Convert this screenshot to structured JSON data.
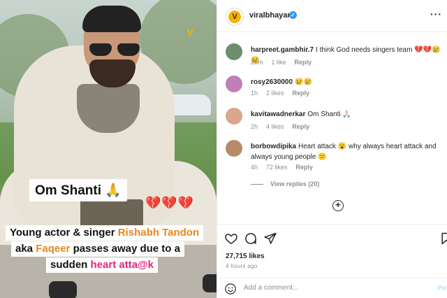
{
  "media": {
    "watermark": "V",
    "overlay_title": "Om Shanti 🙏",
    "hearts": "💔💔💔",
    "caption": {
      "l1_a": "Young actor & singer ",
      "l1_b": "Rishabh Tandon",
      "l2_a": "aka ",
      "l2_b": "Faqeer",
      "l2_c": " passes away due to a",
      "l3_a": "sudden ",
      "l3_b": "heart atta@k"
    }
  },
  "header": {
    "avatar_letter": "V",
    "username": "viralbhayani",
    "verified_mark": "✓",
    "more": "···"
  },
  "comments": [
    {
      "user": "harpreet.gambhir.7",
      "text": "I think God needs singers team 💔💔😢😢",
      "time": "25m",
      "likes": "1 like",
      "reply": "Reply",
      "avatar_color": "#6b8e6b"
    },
    {
      "user": "rosy2630000",
      "text": "😢😢",
      "time": "1h",
      "likes": "2 likes",
      "reply": "Reply",
      "avatar_color": "#c07fb8"
    },
    {
      "user": "kavitawadnerkar",
      "text": "Om Shanti 🙏🏻",
      "time": "2h",
      "likes": "4 likes",
      "reply": "Reply",
      "avatar_color": "#d9a78e"
    },
    {
      "user": "borbowdipika",
      "text": "Heart attack 😮 why always heart attack and always young people 😕",
      "time": "4h",
      "likes": "72 likes",
      "reply": "Reply",
      "avatar_color": "#b88a6a"
    }
  ],
  "view_replies": "View replies (20)",
  "likes_count": "27,715 likes",
  "posted_time": "4 hours ago",
  "add_comment": {
    "placeholder": "Add a comment...",
    "post_label": "Po"
  },
  "colors": {
    "verified": "#3897f0",
    "accent_orange": "#e8871b",
    "accent_pink": "#e0267d",
    "muted": "#8e8e8e"
  }
}
